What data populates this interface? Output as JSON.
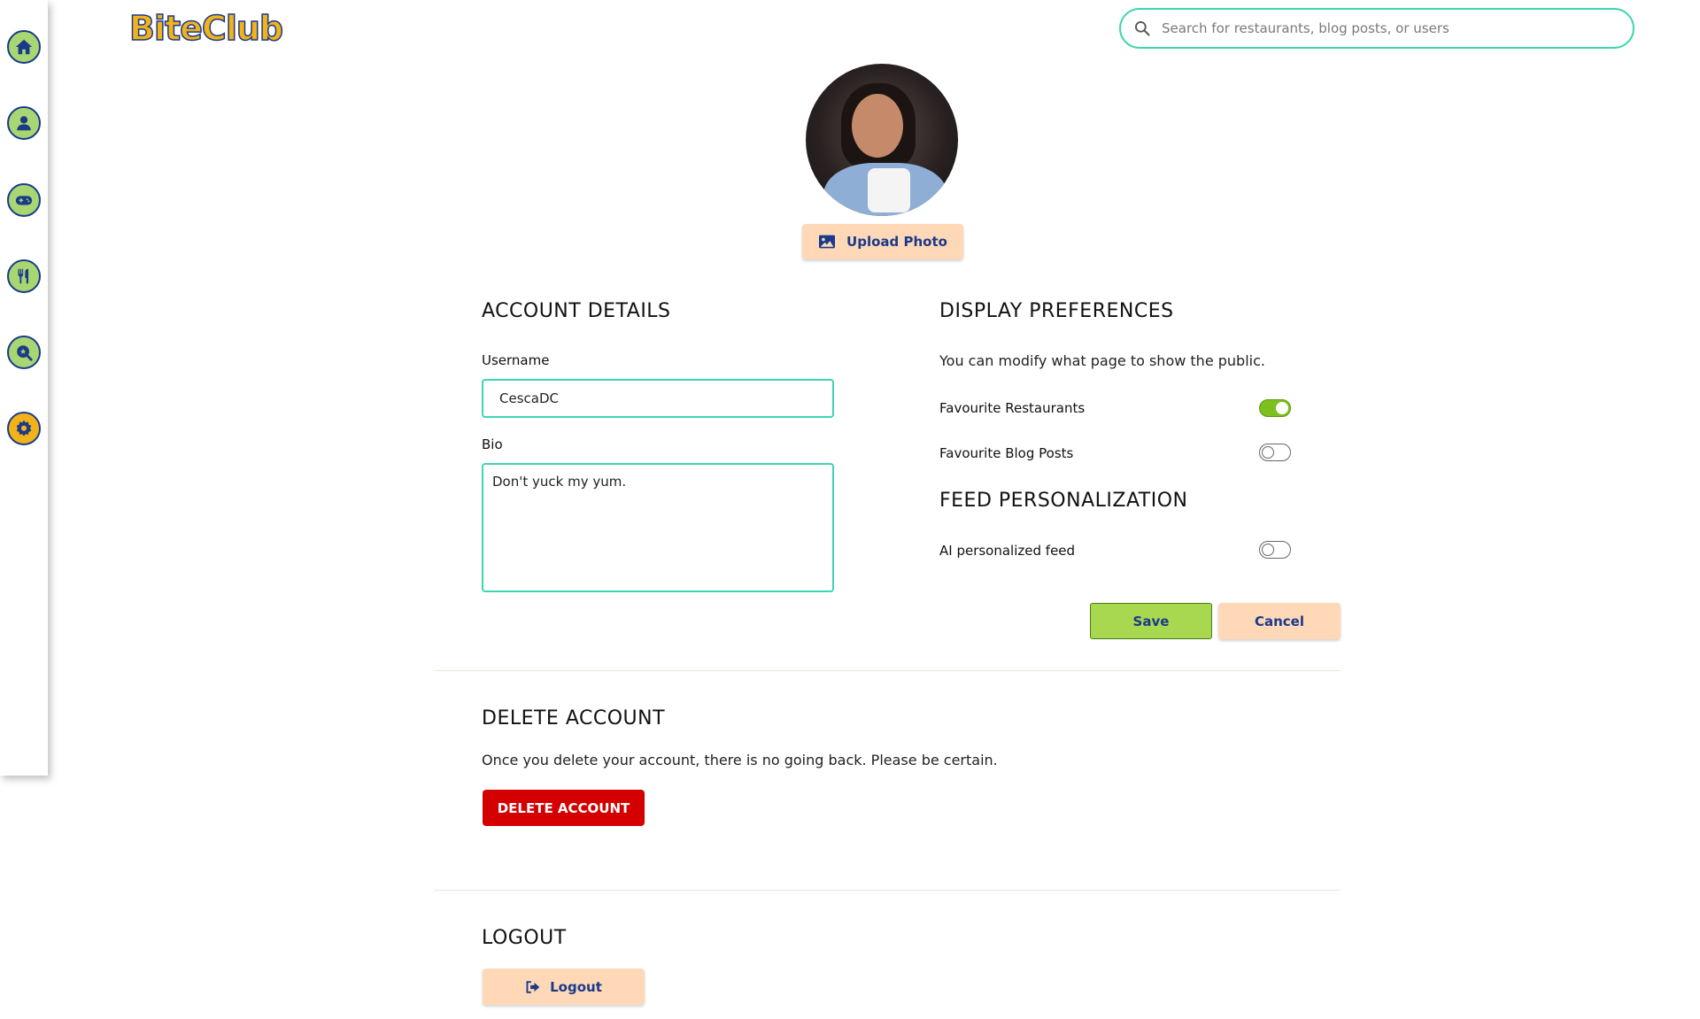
{
  "app": {
    "logo_text": "BiteClub"
  },
  "sidebar": {
    "items": [
      {
        "name": "home",
        "icon": "home-icon",
        "active": false
      },
      {
        "name": "profile",
        "icon": "user-icon",
        "active": false
      },
      {
        "name": "games",
        "icon": "gamepad-icon",
        "active": false
      },
      {
        "name": "restaurants",
        "icon": "utensils-icon",
        "active": false
      },
      {
        "name": "search-reviews",
        "icon": "magnifier-star-icon",
        "active": false
      },
      {
        "name": "settings",
        "icon": "gear-icon",
        "active": true
      }
    ]
  },
  "search": {
    "placeholder": "Search for restaurants, blog posts, or users",
    "value": ""
  },
  "profile": {
    "upload_label": "Upload Photo"
  },
  "account": {
    "heading": "ACCOUNT DETAILS",
    "username_label": "Username",
    "username_value": "CescaDC",
    "bio_label": "Bio",
    "bio_value": "Don't yuck my yum."
  },
  "display": {
    "heading": "DISPLAY PREFERENCES",
    "description": "You can modify what page to show the public.",
    "toggles": [
      {
        "label": "Favourite Restaurants",
        "on": true
      },
      {
        "label": "Favourite Blog Posts",
        "on": false
      }
    ]
  },
  "feed": {
    "heading": "FEED PERSONALIZATION",
    "toggles": [
      {
        "label": "AI personalized feed",
        "on": false
      }
    ]
  },
  "actions": {
    "save_label": "Save",
    "cancel_label": "Cancel"
  },
  "delete": {
    "heading": "DELETE ACCOUNT",
    "description": "Once you delete your account, there is no going back. Please be certain.",
    "button_label": "DELETE ACCOUNT"
  },
  "logout": {
    "heading": "LOGOUT",
    "button_label": "Logout"
  },
  "colors": {
    "accent_teal": "#3dd6b0",
    "brand_yellow": "#f2b21a",
    "nav_green": "#a8d672",
    "navy": "#1a3a8a",
    "peach": "#ffd8b8",
    "danger": "#d40000",
    "save_green": "#a8d84f"
  }
}
